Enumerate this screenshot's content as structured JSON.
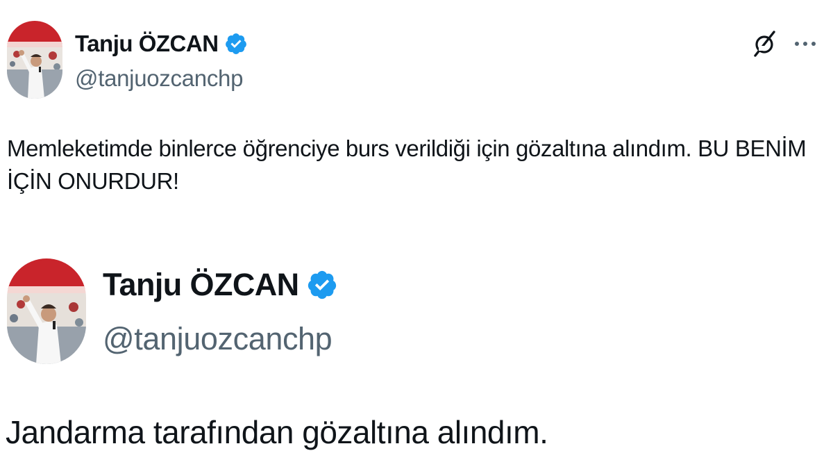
{
  "tweet": {
    "author_name": "Tanju ÖZCAN",
    "author_handle": "@tanjuozcanchp",
    "verified": true,
    "text": "Memleketimde binlerce öğrenciye burs verildiği için gözaltına alındım. BU BENİM İÇİN ONURDUR!",
    "actions": [
      "grok-icon",
      "more-icon"
    ]
  },
  "quoted_tweet": {
    "author_name": "Tanju ÖZCAN",
    "author_handle": "@tanjuozcanchp",
    "verified": true,
    "text": "Jandarma tarafından gözaltına alındım."
  },
  "colors": {
    "text": "#0f1419",
    "secondary_text": "#536471",
    "verified_blue": "#1d9bf0",
    "background": "#ffffff"
  }
}
